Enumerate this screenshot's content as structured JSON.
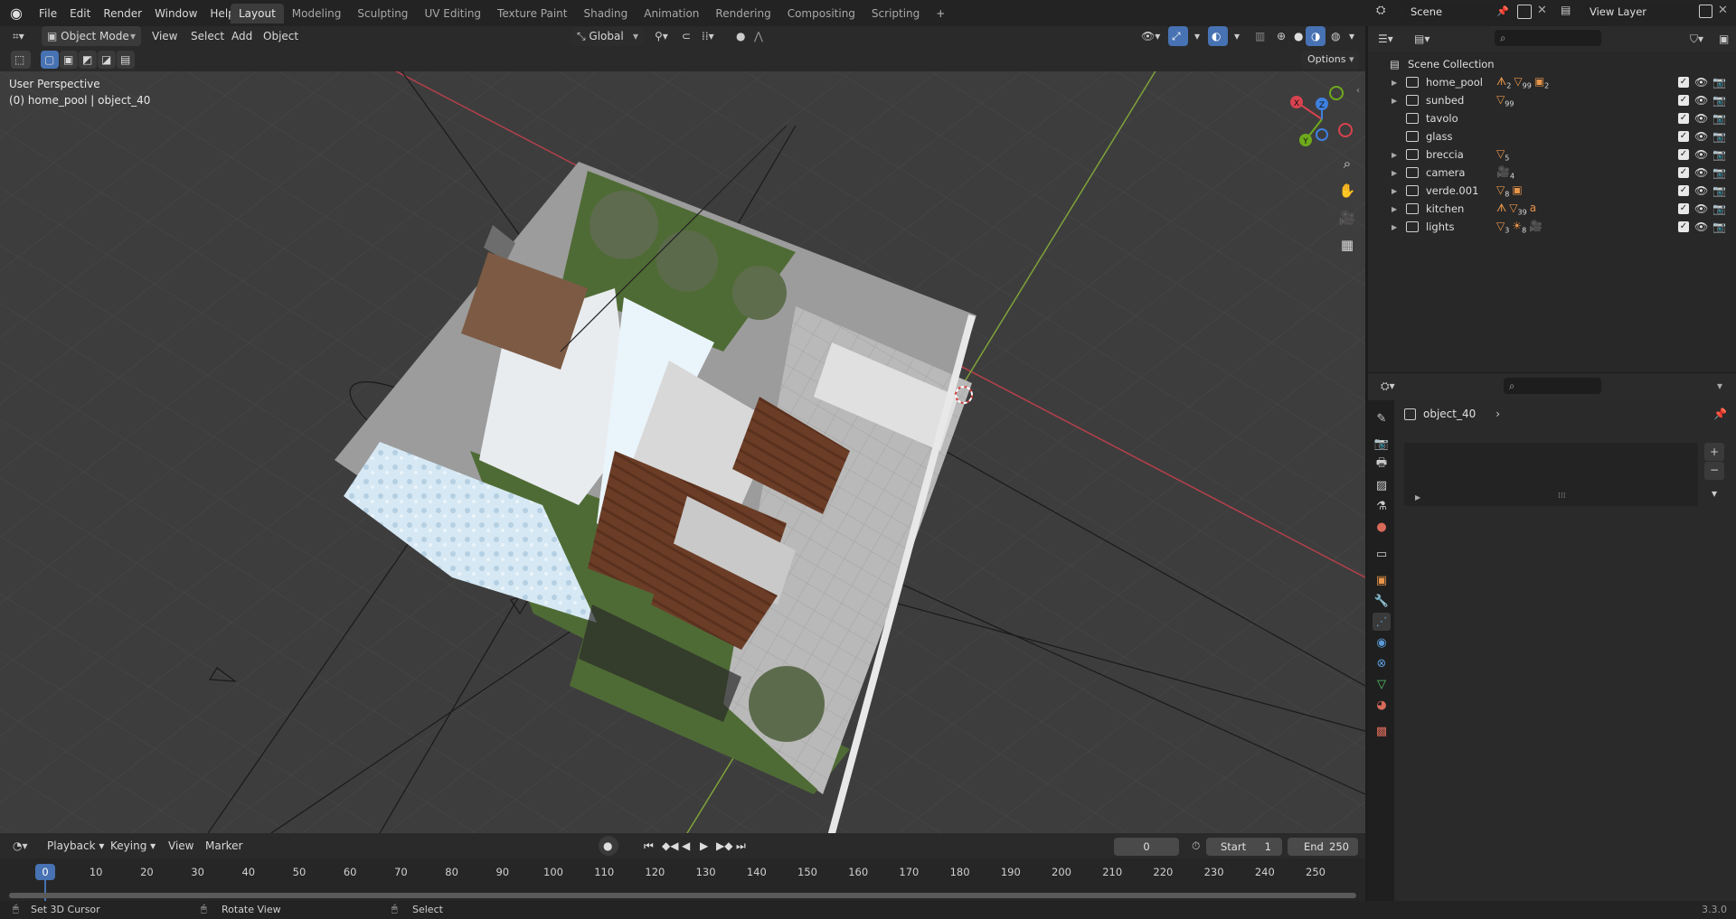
{
  "menu": {
    "items": [
      "File",
      "Edit",
      "Render",
      "Window",
      "Help"
    ]
  },
  "workspaces": [
    "Layout",
    "Modeling",
    "Sculpting",
    "UV Editing",
    "Texture Paint",
    "Shading",
    "Animation",
    "Rendering",
    "Compositing",
    "Scripting"
  ],
  "scene": {
    "name": "Scene",
    "view_layer": "View Layer"
  },
  "viewport": {
    "mode": "Object Mode",
    "menus": [
      "View",
      "Select",
      "Add",
      "Object"
    ],
    "transform_orientation": "Global",
    "options_label": "Options",
    "perspective_label": "User Perspective",
    "object_info": "(0) home_pool | object_40",
    "gizmo": {
      "x": "X",
      "y": "Y",
      "z": "Z",
      "x_color": "#d8434f",
      "y_color": "#6fa91c",
      "z_color": "#3e80e0"
    }
  },
  "outliner": {
    "root": "Scene Collection",
    "items": [
      {
        "name": "home_pool",
        "badges": [
          {
            "icon": "armature-icon",
            "count": "2"
          },
          {
            "icon": "mesh-icon",
            "count": "99"
          },
          {
            "icon": "collection-icon",
            "count": "2"
          }
        ],
        "expandable": true
      },
      {
        "name": "sunbed",
        "badges": [
          {
            "icon": "mesh-icon",
            "count": "99"
          }
        ],
        "expandable": true
      },
      {
        "name": "tavolo",
        "badges": [],
        "expandable": false
      },
      {
        "name": "glass",
        "badges": [],
        "expandable": false
      },
      {
        "name": "breccia",
        "badges": [
          {
            "icon": "mesh-icon",
            "count": "5"
          }
        ],
        "expandable": true
      },
      {
        "name": "camera",
        "badges": [
          {
            "icon": "camera-icon",
            "count": "4"
          }
        ],
        "expandable": true
      },
      {
        "name": "verde.001",
        "badges": [
          {
            "icon": "mesh-icon",
            "count": "8"
          },
          {
            "icon": "collection-icon",
            "count": ""
          }
        ],
        "expandable": true
      },
      {
        "name": "kitchen",
        "badges": [
          {
            "icon": "armature-icon",
            "count": ""
          },
          {
            "icon": "mesh-icon",
            "count": "39"
          },
          {
            "icon": "font-icon",
            "count": ""
          }
        ],
        "expandable": true
      },
      {
        "name": "lights",
        "badges": [
          {
            "icon": "mesh-icon",
            "count": "3"
          },
          {
            "icon": "light-icon",
            "count": "8"
          },
          {
            "icon": "camera-icon",
            "count": ""
          }
        ],
        "expandable": true
      }
    ]
  },
  "properties": {
    "object_name": "object_40",
    "search_placeholder": ""
  },
  "timeline": {
    "menus": [
      "Playback",
      "Keying",
      "View",
      "Marker"
    ],
    "current_frame": "0",
    "start_label": "Start",
    "start": "1",
    "end_label": "End",
    "end": "250",
    "ticks": [
      "0",
      "10",
      "20",
      "30",
      "40",
      "50",
      "60",
      "70",
      "80",
      "90",
      "100",
      "110",
      "120",
      "130",
      "140",
      "150",
      "160",
      "170",
      "180",
      "190",
      "200",
      "210",
      "220",
      "230",
      "240",
      "250"
    ]
  },
  "statusbar": {
    "hint1": "Set 3D Cursor",
    "hint2": "Rotate View",
    "hint3": "Select",
    "version": "3.3.0"
  }
}
